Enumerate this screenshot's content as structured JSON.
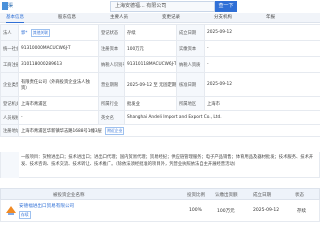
{
  "header": {
    "brand": "渠",
    "search_value": "上海安德福... 有限公司",
    "search_button": "查一下"
  },
  "tabs": [
    "基本信息",
    "股东信息",
    "主要人员",
    "变更记录",
    "分支机构",
    "年报"
  ],
  "info": {
    "legal_person_label": "法人",
    "legal_person_value": "郭*",
    "legal_person_tag": "其他关联",
    "status_label": "登记状态",
    "status_value": "存续",
    "reg_date_label": "成立日期",
    "reg_date_value": "2025-09-12",
    "capital_label": "注册资本",
    "capital_value": "100万元",
    "paidin_label": "实缴资本",
    "paidin_value": "-",
    "credit_label": "统一社会信用代码",
    "credit_value": "91310000MACUCW6J-T",
    "reg_no_label": "工商注册号",
    "reg_no_value": "310118000289613",
    "tax_label": "纳税人识别号",
    "tax_value": "91310118MACUCW6J-T",
    "type_label": "企业类型",
    "type_value": "有限责任公司（外商投资企业法人独资）",
    "term_label": "营业期限",
    "term_value": "2025-09-12 至 无固定期限",
    "qual_label": "纳税人资质",
    "qual_value": "-",
    "industry_label": "所属行业",
    "industry_value": "批发业",
    "approve_label": "核准日期",
    "approve_value": "2025-09-12",
    "authority_label": "登记机关",
    "authority_value": "上海市青浦区",
    "region_label": "所属地区",
    "region_value": "上海市",
    "staff_label": "人员规模",
    "staff_value": "-",
    "insured_label": "参保人数",
    "insured_value": "-",
    "en_name_label": "英文名",
    "en_name_value": "Shanghai Andeli Import and Export Co., Ltd.",
    "former_label": "曾用名",
    "former_value": "-",
    "address_label": "注册地址",
    "address_value": "上海市青浦区华新镇华志路1688号1幢3层",
    "address_tag": "附近企业"
  },
  "scope": {
    "label": "经营范围",
    "text": "一般项目：货物进出口；技术进出口；进出口代理；国内贸易代理；贸易经纪；供应链管理服务；电子产品销售；体育用品及器材批发；技术服务、技术开发、技术咨询、技术交流、技术转让、技术推广。（除依法须经批准的项目外，凭营业执照依法自主开展经营活动）"
  },
  "subsidiaries": {
    "headers": [
      "被投资企业名称",
      "投资比例",
      "认缴出资额",
      "成立日期",
      "状态"
    ],
    "rows": [
      {
        "name": "安德福进出口贸易有限公司",
        "tag": "存续",
        "ratio": "100%",
        "amount": "100万元",
        "date": "2025-09-12",
        "status": "存续"
      }
    ]
  },
  "colors": {
    "accent": "#2f6fd6",
    "label_bg": "#f5f8fc",
    "border": "#e6eaf0"
  }
}
